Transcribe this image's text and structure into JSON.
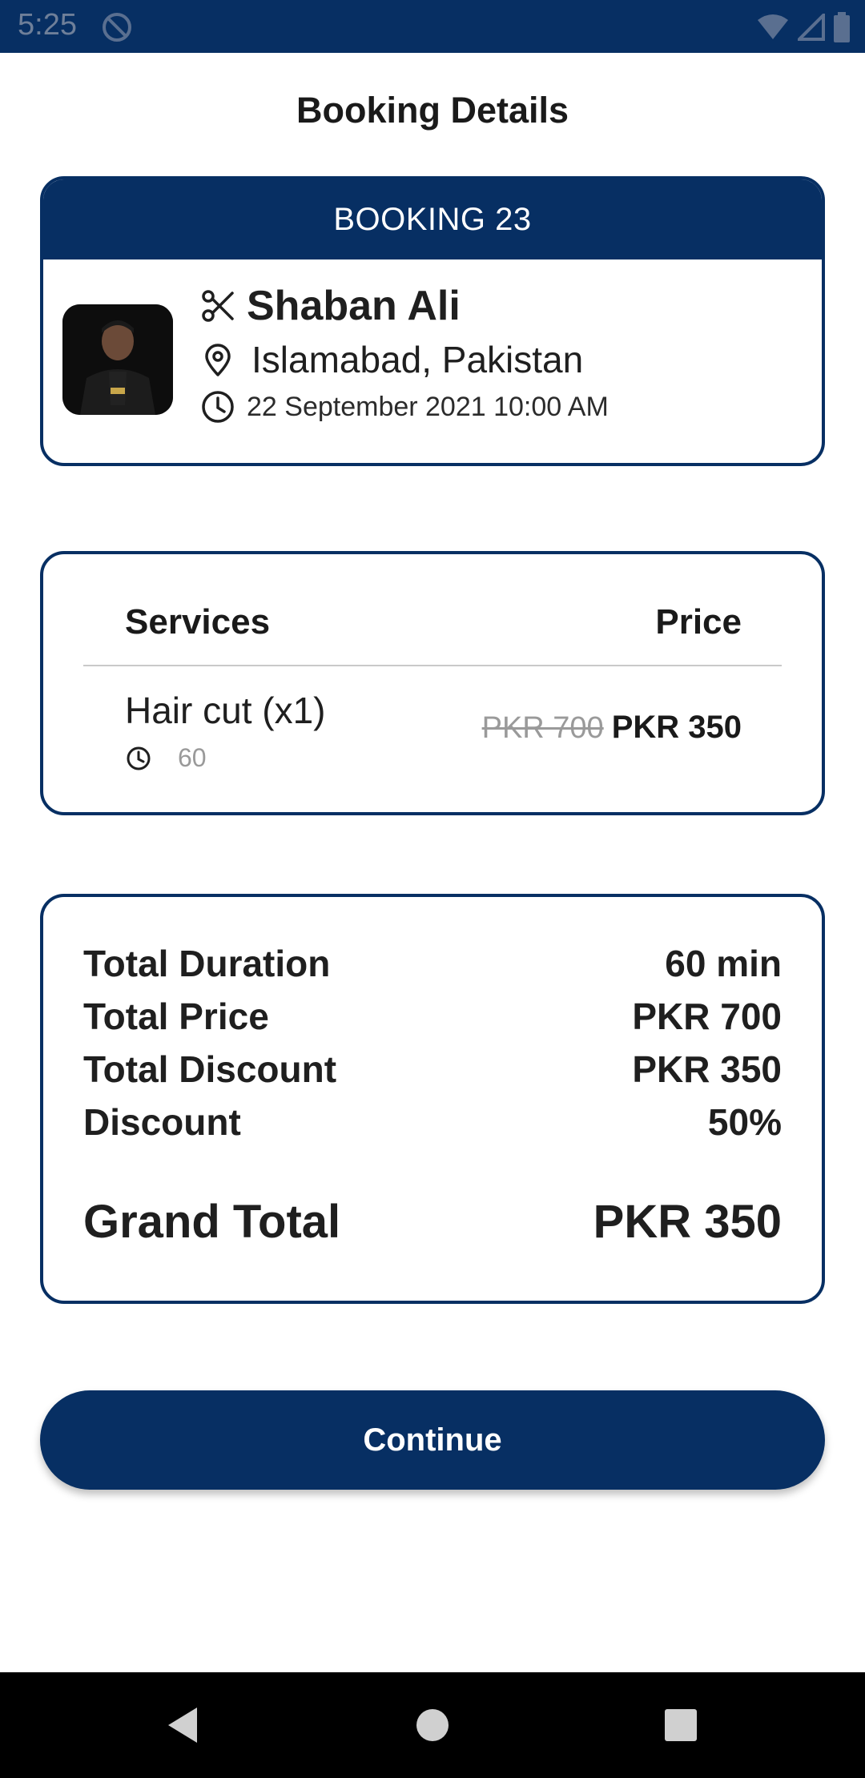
{
  "status_bar": {
    "time": "5:25",
    "icons": [
      "dnd-icon",
      "wifi-icon",
      "signal-icon",
      "battery-icon"
    ]
  },
  "page": {
    "title": "Booking Details"
  },
  "booking": {
    "header": "BOOKING 23",
    "name": "Shaban Ali",
    "location": "Islamabad,  Pakistan",
    "datetime": "22 September 2021 10:00 AM"
  },
  "services": {
    "header_left": "Services",
    "header_right": "Price",
    "items": [
      {
        "name": "Hair cut (x1)",
        "duration": "60",
        "old_price": "PKR 700 ",
        "new_price": "PKR 350"
      }
    ]
  },
  "totals": {
    "rows": [
      {
        "label": "Total Duration",
        "value": "60 min"
      },
      {
        "label": "Total Price",
        "value": "PKR 700"
      },
      {
        "label": "Total Discount",
        "value": "PKR 350"
      },
      {
        "label": "Discount",
        "value": "50%"
      }
    ],
    "grand_label": "Grand Total",
    "grand_value": "PKR 350"
  },
  "actions": {
    "continue_label": "Continue"
  },
  "colors": {
    "primary": "#072f63",
    "muted": "#9a9a9a"
  }
}
